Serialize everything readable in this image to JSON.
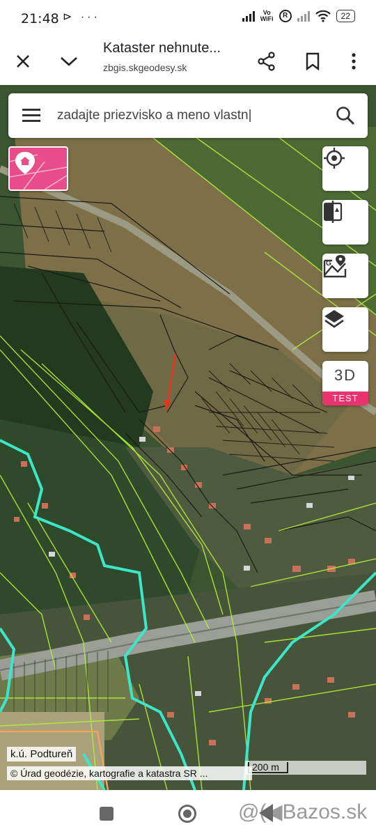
{
  "status_bar": {
    "time": "21:48",
    "left_icons": "⊳ ···",
    "vowifi_top": "Vo",
    "vowifi_bottom": "WiFi",
    "roaming": "R",
    "battery": "22"
  },
  "browser": {
    "title": "Kataster nehnute...",
    "url": "zbgis.skgeodesy.sk",
    "icons": [
      "close-icon",
      "chevron-down-icon",
      "share-icon",
      "bookmark-icon",
      "more-vert-icon"
    ]
  },
  "search": {
    "value": "",
    "placeholder": "zadajte priezvisko a meno vlastn|"
  },
  "map_controls": {
    "geolocate": "crosshair-icon",
    "compare": "compare-icon",
    "google_maps": "google-maps-icon",
    "layers": "layers-icon",
    "three_d_label": "3D",
    "three_d_badge": "TEST"
  },
  "map_footer": {
    "cadastral_area": "k.ú. Podtureň",
    "copyright": "© Úrad geodézie, kartografie a katastra SR ...",
    "scale": "200 m"
  },
  "colors": {
    "parcel_lines": "#b4f03c",
    "boundary_cyan": "#3ee6c8",
    "pink_accent": "#e84d8a",
    "test_badge": "#e8336f",
    "arrow": "#e8341c"
  },
  "watermark": "@(◀Bazos.sk"
}
